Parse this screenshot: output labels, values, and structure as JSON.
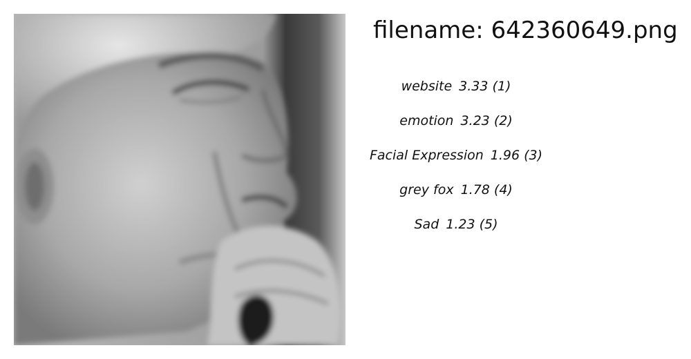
{
  "file": {
    "title": "filename: 642360649.png"
  },
  "tags": [
    {
      "label": "website",
      "score": "3.33 (1)"
    },
    {
      "label": "emotion",
      "score": "3.23 (2)"
    },
    {
      "label": "Facial Expression",
      "score": "1.96 (3)"
    },
    {
      "label": "grey fox",
      "score": "1.78 (4)"
    },
    {
      "label": "Sad",
      "score": "1.23 (5)"
    }
  ]
}
